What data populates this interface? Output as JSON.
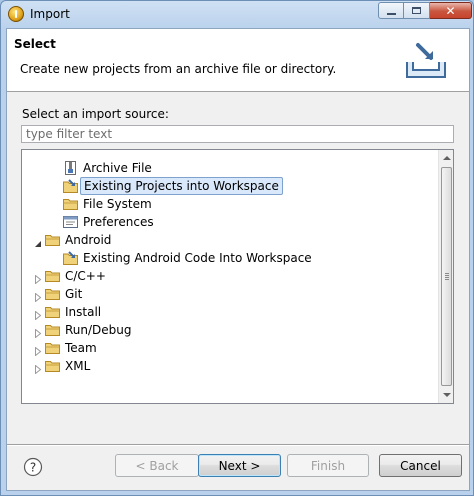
{
  "window": {
    "title": "Import",
    "controls": {
      "minimize": "minimize-icon",
      "maximize": "maximize-icon",
      "close": "close-icon"
    }
  },
  "header": {
    "title": "Select",
    "description": "Create new projects from an archive file or directory."
  },
  "source": {
    "label": "Select an import source:",
    "filter_placeholder": "type filter text",
    "filter_value": ""
  },
  "tree": {
    "items": [
      {
        "label": "Archive File",
        "level": 1,
        "icon": "archive-icon",
        "expanded": null,
        "selected": false
      },
      {
        "label": "Existing Projects into Workspace",
        "level": 1,
        "icon": "projects-icon",
        "expanded": null,
        "selected": true
      },
      {
        "label": "File System",
        "level": 1,
        "icon": "folder-icon",
        "expanded": null,
        "selected": false
      },
      {
        "label": "Preferences",
        "level": 1,
        "icon": "preferences-icon",
        "expanded": null,
        "selected": false
      },
      {
        "label": "Android",
        "level": 0,
        "icon": "folder-icon",
        "expanded": true,
        "selected": false
      },
      {
        "label": "Existing Android Code Into Workspace",
        "level": 1,
        "icon": "android-project-icon",
        "expanded": null,
        "selected": false
      },
      {
        "label": "C/C++",
        "level": 0,
        "icon": "folder-icon",
        "expanded": false,
        "selected": false
      },
      {
        "label": "Git",
        "level": 0,
        "icon": "folder-icon",
        "expanded": false,
        "selected": false
      },
      {
        "label": "Install",
        "level": 0,
        "icon": "folder-icon",
        "expanded": false,
        "selected": false
      },
      {
        "label": "Run/Debug",
        "level": 0,
        "icon": "folder-icon",
        "expanded": false,
        "selected": false
      },
      {
        "label": "Team",
        "level": 0,
        "icon": "folder-icon",
        "expanded": false,
        "selected": false
      },
      {
        "label": "XML",
        "level": 0,
        "icon": "folder-icon",
        "expanded": false,
        "selected": false
      }
    ]
  },
  "buttons": {
    "back": "< Back",
    "next": "Next >",
    "finish": "Finish",
    "cancel": "Cancel"
  },
  "colors": {
    "selection": "#d9e8fb",
    "folder": "#e8c25a",
    "frame": "#b9d1ec"
  }
}
